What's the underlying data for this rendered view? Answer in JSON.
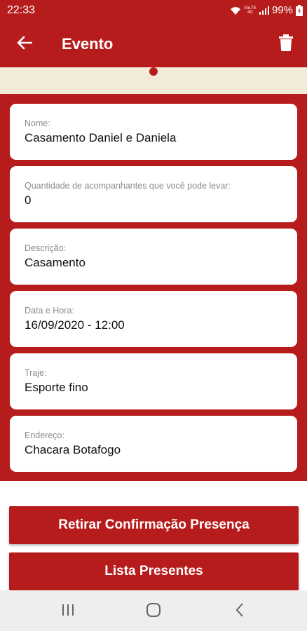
{
  "status_bar": {
    "time": "22:33",
    "network_label": "VoLTE 4G",
    "battery": "99%"
  },
  "app_bar": {
    "title": "Evento"
  },
  "fields": [
    {
      "label": "Nome:",
      "value": "Casamento Daniel e Daniela"
    },
    {
      "label": "Quantidade de acompanhantes que você pode levar:",
      "value": "0"
    },
    {
      "label": "Descrição:",
      "value": "Casamento"
    },
    {
      "label": "Data e Hora:",
      "value": "16/09/2020 - 12:00"
    },
    {
      "label": "Traje:",
      "value": "Esporte fino"
    },
    {
      "label": "Endereço:",
      "value": "Chacara Botafogo"
    }
  ],
  "actions": {
    "remove_confirmation": "Retirar Confirmação Presença",
    "gift_list": "Lista Presentes"
  },
  "colors": {
    "primary": "#b71c1c",
    "strip": "#f1ebd7",
    "nav_bg": "#eeeeee"
  }
}
